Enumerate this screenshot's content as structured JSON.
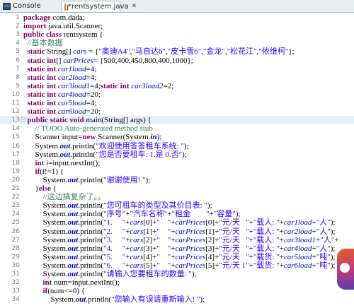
{
  "tabs": {
    "console_label": "Console",
    "editor_label": "*rentsystem.java",
    "close_glyph": "✕"
  },
  "code_lines": [
    {
      "n": "1",
      "fold": "",
      "segs": [
        {
          "c": "kw",
          "t": "package"
        },
        {
          "c": "",
          "t": " com.dada;"
        }
      ]
    },
    {
      "n": "2",
      "fold": "",
      "segs": [
        {
          "c": "kw",
          "t": "import"
        },
        {
          "c": "",
          "t": " java.util.Scanner;"
        }
      ]
    },
    {
      "n": "3",
      "fold": "",
      "segs": [
        {
          "c": "kw",
          "t": "public class"
        },
        {
          "c": "",
          "t": " rentsystem {"
        }
      ]
    },
    {
      "n": "4",
      "fold": "",
      "segs": [
        {
          "c": "cm",
          "t": "  //基本数据"
        }
      ]
    },
    {
      "n": "5",
      "fold": "",
      "segs": [
        {
          "c": "",
          "t": "  "
        },
        {
          "c": "kw",
          "t": "static"
        },
        {
          "c": "",
          "t": " String[] "
        },
        {
          "c": "fld",
          "t": "cars"
        },
        {
          "c": "",
          "t": " = {"
        },
        {
          "c": "str",
          "t": "\"奥迪A4\""
        },
        {
          "c": "",
          "t": ","
        },
        {
          "c": "str",
          "t": "\"马自达6\""
        },
        {
          "c": "",
          "t": ","
        },
        {
          "c": "str",
          "t": "\"皮卡雪6\""
        },
        {
          "c": "",
          "t": ","
        },
        {
          "c": "str",
          "t": "\"金龙\""
        },
        {
          "c": "",
          "t": ","
        },
        {
          "c": "str",
          "t": "\"松花江\""
        },
        {
          "c": "",
          "t": ","
        },
        {
          "c": "str",
          "t": "\"依维柯\""
        },
        {
          "c": "",
          "t": "};"
        }
      ]
    },
    {
      "n": "6",
      "fold": "",
      "segs": [
        {
          "c": "",
          "t": "  "
        },
        {
          "c": "kw",
          "t": "static int"
        },
        {
          "c": "",
          "t": "[] "
        },
        {
          "c": "fld",
          "t": "carPrices"
        },
        {
          "c": "",
          "t": "= {500,400,450,800,400,1000};"
        }
      ]
    },
    {
      "n": "7",
      "fold": "",
      "segs": [
        {
          "c": "",
          "t": "  "
        },
        {
          "c": "kw",
          "t": "static int"
        },
        {
          "c": "",
          "t": " "
        },
        {
          "c": "fld",
          "t": "car1load"
        },
        {
          "c": "",
          "t": "=4;"
        }
      ]
    },
    {
      "n": "8",
      "fold": "",
      "segs": [
        {
          "c": "",
          "t": "  "
        },
        {
          "c": "kw",
          "t": "static int"
        },
        {
          "c": "",
          "t": " "
        },
        {
          "c": "fld",
          "t": "car2load"
        },
        {
          "c": "",
          "t": "=4;"
        }
      ]
    },
    {
      "n": "9",
      "fold": "",
      "segs": [
        {
          "c": "",
          "t": "  "
        },
        {
          "c": "kw",
          "t": "static int"
        },
        {
          "c": "",
          "t": " "
        },
        {
          "c": "fld",
          "t": "car3load1"
        },
        {
          "c": "",
          "t": "=4;"
        },
        {
          "c": "kw",
          "t": "static int"
        },
        {
          "c": "",
          "t": " "
        },
        {
          "c": "fld",
          "t": "car3load2"
        },
        {
          "c": "",
          "t": "=2;"
        }
      ]
    },
    {
      "n": "10",
      "fold": "",
      "segs": [
        {
          "c": "",
          "t": "  "
        },
        {
          "c": "kw",
          "t": "static int"
        },
        {
          "c": "",
          "t": " "
        },
        {
          "c": "fld",
          "t": "car4load"
        },
        {
          "c": "",
          "t": "=20;"
        }
      ]
    },
    {
      "n": "11",
      "fold": "",
      "segs": [
        {
          "c": "",
          "t": "  "
        },
        {
          "c": "kw",
          "t": "static int"
        },
        {
          "c": "",
          "t": " "
        },
        {
          "c": "fld",
          "t": "car5load"
        },
        {
          "c": "",
          "t": "=4;"
        }
      ]
    },
    {
      "n": "12",
      "fold": "",
      "segs": [
        {
          "c": "",
          "t": "  "
        },
        {
          "c": "kw",
          "t": "static int"
        },
        {
          "c": "",
          "t": " "
        },
        {
          "c": "fld",
          "t": "car6load"
        },
        {
          "c": "",
          "t": "=20;"
        }
      ]
    },
    {
      "n": "13",
      "fold": "−",
      "segs": [
        {
          "c": "",
          "t": "  "
        },
        {
          "c": "kw",
          "t": "public static void"
        },
        {
          "c": "",
          "t": " main(String[] args) {"
        }
      ]
    },
    {
      "n": "14",
      "fold": "",
      "segs": [
        {
          "c": "cm",
          "t": "      // TODO Auto-generated method stub"
        }
      ]
    },
    {
      "n": "15",
      "fold": "",
      "segs": [
        {
          "c": "",
          "t": "      Scanner input="
        },
        {
          "c": "kw",
          "t": "new"
        },
        {
          "c": "",
          "t": " Scanner(System."
        },
        {
          "c": "sf",
          "t": "in"
        },
        {
          "c": "",
          "t": ");"
        }
      ]
    },
    {
      "n": "16",
      "fold": "",
      "segs": [
        {
          "c": "",
          "t": "      System."
        },
        {
          "c": "sf",
          "t": "out"
        },
        {
          "c": "",
          "t": ".println("
        },
        {
          "c": "str",
          "t": "\"欢迎使用答答租车系统: \""
        },
        {
          "c": "",
          "t": ");"
        }
      ]
    },
    {
      "n": "17",
      "fold": "",
      "segs": [
        {
          "c": "",
          "t": "      System."
        },
        {
          "c": "sf",
          "t": "out"
        },
        {
          "c": "",
          "t": ".println("
        },
        {
          "c": "str",
          "t": "\"您是否要租车: 1.是 0.否\""
        },
        {
          "c": "",
          "t": ");"
        }
      ]
    },
    {
      "n": "18",
      "fold": "",
      "segs": [
        {
          "c": "",
          "t": "      "
        },
        {
          "c": "kw",
          "t": "int"
        },
        {
          "c": "",
          "t": " i=input.nextInt();"
        }
      ]
    },
    {
      "n": "19",
      "fold": "",
      "segs": [
        {
          "c": "",
          "t": "      "
        },
        {
          "c": "kw",
          "t": "if"
        },
        {
          "c": "",
          "t": "(i!=1) {"
        }
      ]
    },
    {
      "n": "20",
      "fold": "",
      "segs": [
        {
          "c": "",
          "t": "          System."
        },
        {
          "c": "sf",
          "t": "out"
        },
        {
          "c": "",
          "t": ".println("
        },
        {
          "c": "str",
          "t": "\"谢谢使用! \""
        },
        {
          "c": "",
          "t": ");"
        }
      ]
    },
    {
      "n": "21",
      "fold": "",
      "segs": [
        {
          "c": "",
          "t": "      }"
        },
        {
          "c": "kw",
          "t": "else"
        },
        {
          "c": "",
          "t": " {"
        }
      ]
    },
    {
      "n": "22",
      "fold": "",
      "segs": [
        {
          "c": "cm",
          "t": "          //这边搞复杂了。。"
        }
      ]
    },
    {
      "n": "23",
      "fold": "",
      "segs": [
        {
          "c": "",
          "t": "          System."
        },
        {
          "c": "sf",
          "t": "out"
        },
        {
          "c": "",
          "t": ".println("
        },
        {
          "c": "str",
          "t": "\"您可租车的类型及其价目表: \""
        },
        {
          "c": "",
          "t": ");"
        }
      ]
    },
    {
      "n": "24",
      "fold": "",
      "segs": [
        {
          "c": "",
          "t": "          System."
        },
        {
          "c": "sf",
          "t": "out"
        },
        {
          "c": "",
          "t": ".println("
        },
        {
          "c": "str",
          "t": "\"序号\""
        },
        {
          "c": "",
          "t": "+"
        },
        {
          "c": "str",
          "t": "\"汽车名称\""
        },
        {
          "c": "",
          "t": "+"
        },
        {
          "c": "str",
          "t": "\"租金        \""
        },
        {
          "c": "",
          "t": "+"
        },
        {
          "c": "str",
          "t": "\"容量\""
        },
        {
          "c": "",
          "t": ");"
        }
      ]
    },
    {
      "n": "25",
      "fold": "",
      "segs": [
        {
          "c": "",
          "t": "          System."
        },
        {
          "c": "sf",
          "t": "out"
        },
        {
          "c": "",
          "t": ".println("
        },
        {
          "c": "str",
          "t": "\"1.     \""
        },
        {
          "c": "",
          "t": "+"
        },
        {
          "c": "fld",
          "t": "cars"
        },
        {
          "c": "",
          "t": "[0]+"
        },
        {
          "c": "str",
          "t": "\"    \""
        },
        {
          "c": "",
          "t": "+"
        },
        {
          "c": "fld",
          "t": "carPrices"
        },
        {
          "c": "",
          "t": "[0]+"
        },
        {
          "c": "str",
          "t": "\"元/天   \""
        },
        {
          "c": "",
          "t": "+"
        },
        {
          "c": "str",
          "t": "\"载人: \""
        },
        {
          "c": "",
          "t": "+"
        },
        {
          "c": "fld",
          "t": "car1load"
        },
        {
          "c": "",
          "t": "+"
        },
        {
          "c": "str",
          "t": "\"人\""
        },
        {
          "c": "",
          "t": ");"
        }
      ]
    },
    {
      "n": "26",
      "fold": "",
      "segs": [
        {
          "c": "",
          "t": "          System."
        },
        {
          "c": "sf",
          "t": "out"
        },
        {
          "c": "",
          "t": ".println("
        },
        {
          "c": "str",
          "t": "\"2.     \""
        },
        {
          "c": "",
          "t": "+"
        },
        {
          "c": "fld",
          "t": "cars"
        },
        {
          "c": "",
          "t": "[1]+"
        },
        {
          "c": "str",
          "t": "\"    \""
        },
        {
          "c": "",
          "t": "+"
        },
        {
          "c": "fld",
          "t": "carPrices"
        },
        {
          "c": "",
          "t": "[1]+"
        },
        {
          "c": "str",
          "t": "\"元/天   \""
        },
        {
          "c": "",
          "t": "+"
        },
        {
          "c": "str",
          "t": "\"载人: \""
        },
        {
          "c": "",
          "t": "+"
        },
        {
          "c": "fld",
          "t": "car2load"
        },
        {
          "c": "",
          "t": "+"
        },
        {
          "c": "str",
          "t": "\"人\""
        },
        {
          "c": "",
          "t": ");"
        }
      ]
    },
    {
      "n": "27",
      "fold": "",
      "segs": [
        {
          "c": "",
          "t": "          System."
        },
        {
          "c": "sf",
          "t": "out"
        },
        {
          "c": "",
          "t": ".println("
        },
        {
          "c": "str",
          "t": "\"3.     \""
        },
        {
          "c": "",
          "t": "+"
        },
        {
          "c": "fld",
          "t": "cars"
        },
        {
          "c": "",
          "t": "[2]+"
        },
        {
          "c": "str",
          "t": "\"    \""
        },
        {
          "c": "",
          "t": "+"
        },
        {
          "c": "fld",
          "t": "carPrices"
        },
        {
          "c": "",
          "t": "[2]+"
        },
        {
          "c": "str",
          "t": "\"元/天   \""
        },
        {
          "c": "",
          "t": "+"
        },
        {
          "c": "str",
          "t": "\"载人: \""
        },
        {
          "c": "",
          "t": "+"
        },
        {
          "c": "fld",
          "t": "car3load1"
        },
        {
          "c": "",
          "t": "+"
        },
        {
          "c": "str",
          "t": "\"人\""
        },
        {
          "c": "",
          "t": "+"
        }
      ]
    },
    {
      "n": "28",
      "fold": "",
      "segs": [
        {
          "c": "",
          "t": "          System."
        },
        {
          "c": "sf",
          "t": "out"
        },
        {
          "c": "",
          "t": ".println("
        },
        {
          "c": "str",
          "t": "\"4.     \""
        },
        {
          "c": "",
          "t": "+"
        },
        {
          "c": "fld",
          "t": "cars"
        },
        {
          "c": "",
          "t": "[3]+"
        },
        {
          "c": "str",
          "t": "\"    \""
        },
        {
          "c": "",
          "t": "+"
        },
        {
          "c": "fld",
          "t": "carPrices"
        },
        {
          "c": "",
          "t": "[3]+"
        },
        {
          "c": "str",
          "t": "\"元/天   \""
        },
        {
          "c": "",
          "t": "+"
        },
        {
          "c": "str",
          "t": "\"载人: \""
        },
        {
          "c": "",
          "t": "+"
        },
        {
          "c": "fld",
          "t": "car4load"
        },
        {
          "c": "",
          "t": "+"
        },
        {
          "c": "str",
          "t": "\"人\""
        },
        {
          "c": "",
          "t": ");"
        }
      ]
    },
    {
      "n": "29",
      "fold": "",
      "segs": [
        {
          "c": "",
          "t": "          System."
        },
        {
          "c": "sf",
          "t": "out"
        },
        {
          "c": "",
          "t": ".println("
        },
        {
          "c": "str",
          "t": "\"5.     \""
        },
        {
          "c": "",
          "t": "+"
        },
        {
          "c": "fld",
          "t": "cars"
        },
        {
          "c": "",
          "t": "[4]+"
        },
        {
          "c": "str",
          "t": "\"    \""
        },
        {
          "c": "",
          "t": "+"
        },
        {
          "c": "fld",
          "t": "carPrices"
        },
        {
          "c": "",
          "t": "[4]+"
        },
        {
          "c": "str",
          "t": "\"元/天   \""
        },
        {
          "c": "",
          "t": "+"
        },
        {
          "c": "str",
          "t": "\"载货: \""
        },
        {
          "c": "",
          "t": "+"
        },
        {
          "c": "fld",
          "t": "car5load"
        },
        {
          "c": "",
          "t": "+"
        },
        {
          "c": "str",
          "t": "\"吨\""
        },
        {
          "c": "",
          "t": ");"
        }
      ]
    },
    {
      "n": "30",
      "fold": "",
      "segs": [
        {
          "c": "",
          "t": "          System."
        },
        {
          "c": "sf",
          "t": "out"
        },
        {
          "c": "",
          "t": ".println("
        },
        {
          "c": "str",
          "t": "\"6.     \""
        },
        {
          "c": "",
          "t": "+"
        },
        {
          "c": "fld",
          "t": "cars"
        },
        {
          "c": "",
          "t": "[5]+"
        },
        {
          "c": "str",
          "t": "\"    \""
        },
        {
          "c": "",
          "t": "+"
        },
        {
          "c": "fld",
          "t": "carPrices"
        },
        {
          "c": "",
          "t": "[5]+"
        },
        {
          "c": "str",
          "t": "\"元/天 1\""
        },
        {
          "c": "",
          "t": "+"
        },
        {
          "c": "str",
          "t": "\"载货: \""
        },
        {
          "c": "",
          "t": "+"
        },
        {
          "c": "fld",
          "t": "car6load"
        },
        {
          "c": "",
          "t": "+"
        },
        {
          "c": "str",
          "t": "\"吨\""
        },
        {
          "c": "",
          "t": ");"
        }
      ]
    },
    {
      "n": "31",
      "fold": "",
      "segs": [
        {
          "c": "",
          "t": "          System."
        },
        {
          "c": "sf",
          "t": "out"
        },
        {
          "c": "",
          "t": ".println("
        },
        {
          "c": "str",
          "t": "\"请输入您要租车的数量: \""
        },
        {
          "c": "",
          "t": ");"
        }
      ]
    },
    {
      "n": "32",
      "fold": "",
      "segs": [
        {
          "c": "",
          "t": "          "
        },
        {
          "c": "kw",
          "t": "int"
        },
        {
          "c": "",
          "t": " num=input.nextInt();"
        }
      ]
    },
    {
      "n": "33",
      "fold": "",
      "segs": [
        {
          "c": "",
          "t": "          "
        },
        {
          "c": "kw",
          "t": "if"
        },
        {
          "c": "",
          "t": "(num<=0) {"
        }
      ]
    },
    {
      "n": "34",
      "fold": "",
      "segs": [
        {
          "c": "",
          "t": "              System."
        },
        {
          "c": "sf",
          "t": "out"
        },
        {
          "c": "",
          "t": ".println("
        },
        {
          "c": "str",
          "t": "\"您输入有误请重新输入! \""
        },
        {
          "c": "",
          "t": ");"
        }
      ]
    }
  ],
  "highlight_line": "13"
}
